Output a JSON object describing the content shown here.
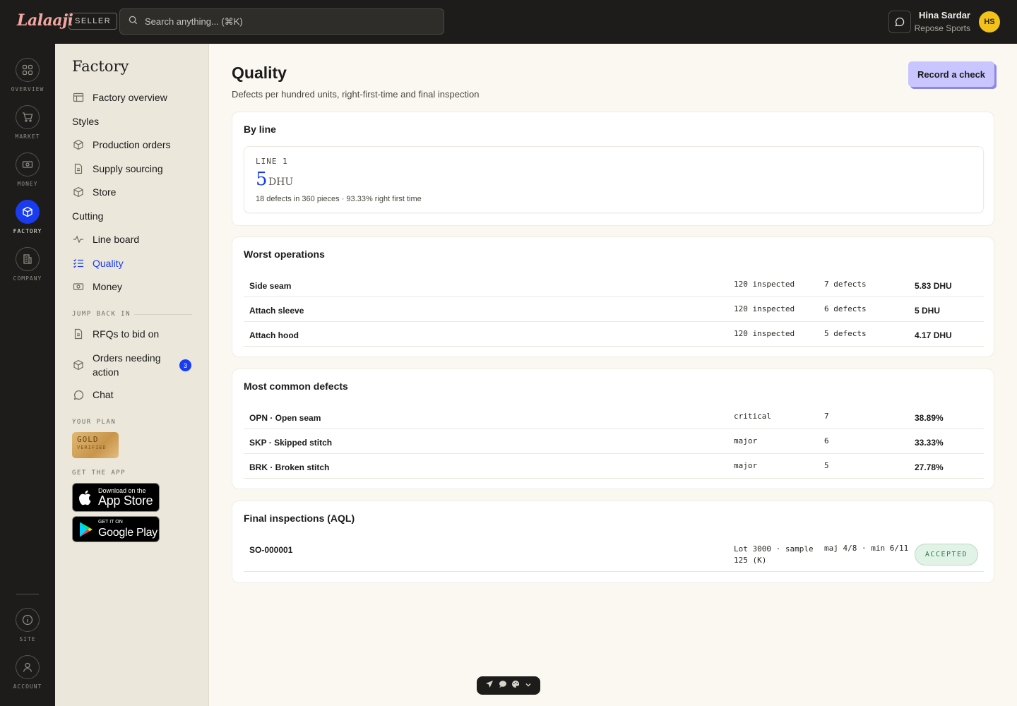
{
  "topbar": {
    "logo": "Lalaaji",
    "role_badge": "SELLER",
    "search_placeholder": "Search anything... (⌘K)",
    "user_name": "Hina Sardar",
    "user_company": "Repose Sports",
    "avatar_initials": "HS"
  },
  "rail": {
    "items": [
      {
        "label": "OVERVIEW",
        "icon": "grid-icon"
      },
      {
        "label": "MARKET",
        "icon": "cart-icon"
      },
      {
        "label": "MONEY",
        "icon": "money-icon"
      },
      {
        "label": "FACTORY",
        "icon": "box-icon",
        "active": true
      },
      {
        "label": "COMPANY",
        "icon": "building-icon"
      },
      {
        "label": "SITE",
        "icon": "info-icon"
      },
      {
        "label": "ACCOUNT",
        "icon": "user-icon"
      }
    ]
  },
  "sidebar": {
    "title": "Factory",
    "overview": "Factory overview",
    "section_styles": "Styles",
    "production_orders": "Production orders",
    "supply_sourcing": "Supply sourcing",
    "store": "Store",
    "section_cutting": "Cutting",
    "line_board": "Line board",
    "quality": "Quality",
    "money": "Money",
    "jump_back_caption": "JUMP BACK IN",
    "rfqs": "RFQs to bid on",
    "orders_action_1": "Orders needing",
    "orders_action_2": "action",
    "orders_badge": "3",
    "chat": "Chat",
    "plan_caption": "YOUR PLAN",
    "plan_name": "GOLD",
    "plan_status": "VERIFIED",
    "app_caption": "GET THE APP",
    "appstore_small": "Download on the",
    "appstore_big": "App Store",
    "play_small": "GET IT ON",
    "play_big": "Google Play"
  },
  "main": {
    "title": "Quality",
    "subtitle": "Defects per hundred units, right-first-time and final inspection",
    "record_button": "Record a check",
    "by_line": {
      "title": "By line",
      "line_label": "LINE 1",
      "dhu_value": "5",
      "dhu_unit": "DHU",
      "note": "18 defects in 360 pieces · 93.33% right first time"
    },
    "worst_operations": {
      "title": "Worst operations",
      "rows": [
        {
          "name": "Side seam",
          "inspected": "120 inspected",
          "defects": "7 defects",
          "dhu": "5.83 DHU"
        },
        {
          "name": "Attach sleeve",
          "inspected": "120 inspected",
          "defects": "6 defects",
          "dhu": "5 DHU"
        },
        {
          "name": "Attach hood",
          "inspected": "120 inspected",
          "defects": "5 defects",
          "dhu": "4.17 DHU"
        }
      ]
    },
    "common_defects": {
      "title": "Most common defects",
      "rows": [
        {
          "name": "OPN · Open seam",
          "severity": "critical",
          "count": "7",
          "share": "38.89%"
        },
        {
          "name": "SKP · Skipped stitch",
          "severity": "major",
          "count": "6",
          "share": "33.33%"
        },
        {
          "name": "BRK · Broken stitch",
          "severity": "major",
          "count": "5",
          "share": "27.78%"
        }
      ]
    },
    "final_inspections": {
      "title": "Final inspections (AQL)",
      "rows": [
        {
          "order": "SO-000001",
          "lot_1": "Lot 3000 · sample",
          "lot_2": "125 (K)",
          "result": "maj 4/8 · min 6/11",
          "status": "ACCEPTED"
        }
      ]
    }
  },
  "colors": {
    "accent": "#1a3cf0",
    "topbar_bg": "#1d1c1a",
    "sidebar_bg": "#ece7db",
    "page_bg": "#fbf8f2",
    "avatar_bg": "#f2c21b",
    "record_button_bg": "#c9c6ff",
    "accepted_bg": "#e1f3e7"
  }
}
